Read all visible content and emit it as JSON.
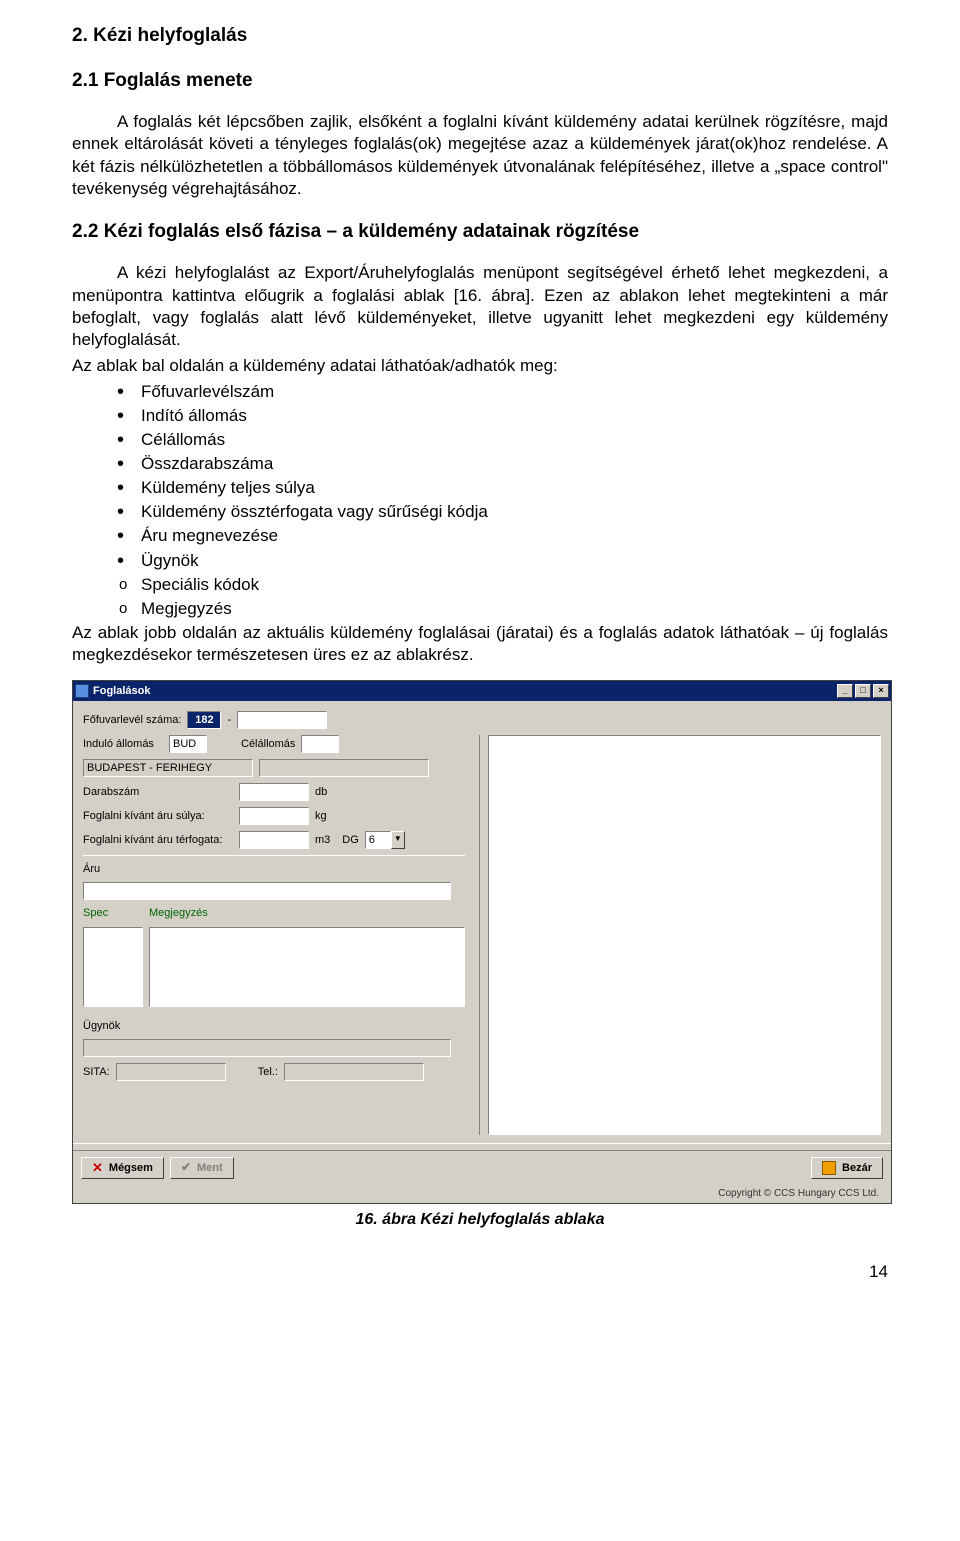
{
  "doc": {
    "heading": "2. Kézi helyfoglalás",
    "sub_heading_1": "2.1 Foglalás menete",
    "para_1": "A foglalás két lépcsőben zajlik, elsőként a foglalni kívánt küldemény adatai kerülnek rögzítésre, majd ennek eltárolását követi a tényleges foglalás(ok) megejtése azaz a küldemények járat(ok)hoz rendelése. A két fázis nélkülözhetetlen a többállomásos küldemények útvonalának felépítéséhez, illetve a „space control\" tevékenység végrehajtásához.",
    "sub_heading_2": "2.2 Kézi foglalás első fázisa – a küldemény adatainak rögzítése",
    "para_2": "A kézi helyfoglalást az Export/Áruhelyfoglalás menüpont segítségével érhető lehet megkezdeni, a menüpontra kattintva előugrik a foglalási ablak [16. ábra]. Ezen az ablakon lehet megtekinteni a már befoglalt, vagy foglalás alatt lévő küldeményeket, illetve ugyanitt lehet megkezdeni egy küldemény helyfoglalását.",
    "para_3": "Az ablak bal oldalán a küldemény adatai láthatóak/adhatók meg:",
    "bullets": [
      "Főfuvarlevélszám",
      "Indító állomás",
      "Célállomás",
      "Összdarabszáma",
      "Küldemény teljes súlya",
      "Küldemény össztérfogata vagy sűrűségi kódja",
      "Áru megnevezése",
      "Ügynök",
      "Speciális kódok",
      "Megjegyzés"
    ],
    "para_4": "Az ablak jobb oldalán az aktuális küldemény foglalásai (járatai) és a foglalás adatok láthatóak – új foglalás megkezdésekor természetesen üres ez az ablakrész.",
    "caption": "16. ábra Kézi helyfoglalás ablaka",
    "page_number": "14"
  },
  "app": {
    "title": "Foglalások",
    "winbtns": {
      "min": "_",
      "max": "□",
      "close": "×"
    },
    "awb_label": "Főfuvarlevél száma:",
    "awb_prefix": "182",
    "awb_dash": "-",
    "origin_label": "Induló állomás",
    "origin_value": "BUD",
    "dest_label": "Célállomás",
    "origin_long": "BUDAPEST - FERIHEGY",
    "pieces_label": "Darabszám",
    "pieces_unit": "db",
    "weight_label": "Foglalni kívánt áru súlya:",
    "weight_unit": "kg",
    "volume_label": "Foglalni kívánt áru térfogata:",
    "volume_unit": "m3",
    "dg_label": "DG",
    "dg_value": "6",
    "aru_label": "Áru",
    "spec_label": "Spec",
    "remark_label": "Megjegyzés",
    "agent_label": "Ügynök",
    "sita_label": "SITA:",
    "tel_label": "Tel.:",
    "cancel_btn": "Mégsem",
    "save_btn": "Ment",
    "close_btn": "Bezár",
    "copyright": "Copyright © CCS Hungary CCS Ltd."
  }
}
